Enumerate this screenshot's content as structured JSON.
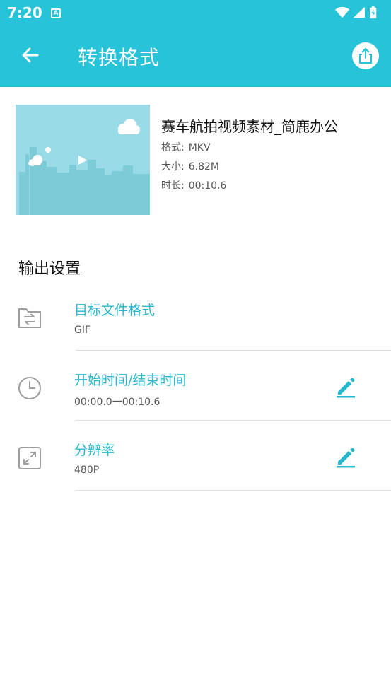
{
  "status_bar": {
    "time": "7:20",
    "notification_letter": "A"
  },
  "app_bar": {
    "title": "转换格式",
    "back_icon": "arrow-left-icon",
    "share_icon": "share-icon"
  },
  "colors": {
    "primary": "#27c3d8",
    "accent_text": "#27b8cd",
    "thumbnail_bg": "#98dbe6"
  },
  "video": {
    "name": "赛车航拍视频素材_简鹿办公",
    "format_label": "格式:",
    "format_value": "MKV",
    "size_label": "大小:",
    "size_value": "6.82M",
    "duration_label": "时长:",
    "duration_value": "00:10.6"
  },
  "output": {
    "section_title": "输出设置",
    "items": [
      {
        "label": "目标文件格式",
        "value": "GIF",
        "icon": "folder-convert-icon"
      },
      {
        "label": "开始时间/结束时间",
        "value": "00:00.0一00:10.6",
        "icon": "clock-icon",
        "edit_icon": "pencil-icon"
      },
      {
        "label": "分辨率",
        "value": "480P",
        "icon": "expand-icon",
        "edit_icon": "pencil-icon"
      }
    ]
  }
}
